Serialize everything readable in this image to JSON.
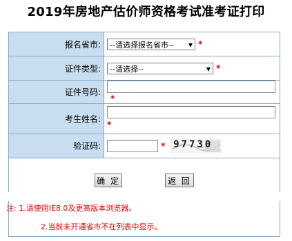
{
  "page": {
    "title": "2019年房地产估价师资格考试准考证打印"
  },
  "form": {
    "province": {
      "label": "报名省市:",
      "selected": "--请选择报名省市--",
      "required_mark": "*"
    },
    "id_type": {
      "label": "证件类型:",
      "selected": "--请选择--",
      "required_mark": "*"
    },
    "id_number": {
      "label": "证件号码:",
      "value": "",
      "required_mark": "*"
    },
    "name": {
      "label": "考生姓名:",
      "value": "",
      "required_mark": "*"
    },
    "captcha": {
      "label": "验证码:",
      "value": "",
      "required_mark": "*",
      "image_text": "97730"
    }
  },
  "buttons": {
    "confirm": "确 定",
    "back": "返 回"
  },
  "notes": {
    "line1": "注: 1.请使用IE8.0及更高版本浏览器。",
    "line2": "2.当前未开通省市不在列表中显示。"
  },
  "colors": {
    "label_bg": "#c8ddef",
    "border": "#86a8c8",
    "required": "#e00000"
  }
}
